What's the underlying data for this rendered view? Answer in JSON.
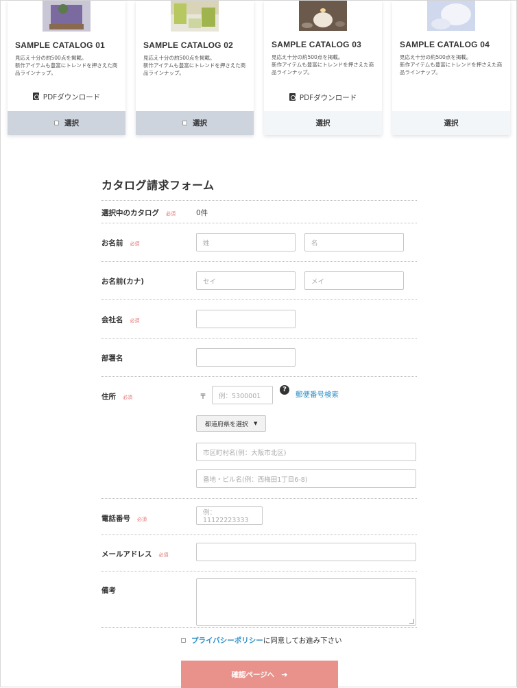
{
  "catalogs": [
    {
      "title": "SAMPLE CATALOG 01",
      "desc_line1": "見応え十分の約500点を掲載。",
      "desc_line2": "新作アイテムも豊富にトレンドを押さえた商品ラインナップ。",
      "pdf_label": "PDFダウンロード",
      "select_label": "選択",
      "has_pdf": true,
      "state": "checkbox"
    },
    {
      "title": "SAMPLE CATALOG 02",
      "desc_line1": "見応え十分の約500点を掲載。",
      "desc_line2": "新作アイテムも豊富にトレンドを押さえた商品ラインナップ。",
      "pdf_label": "",
      "select_label": "選択",
      "has_pdf": false,
      "state": "checkbox"
    },
    {
      "title": "SAMPLE CATALOG 03",
      "desc_line1": "見応え十分の約500点を掲載。",
      "desc_line2": "新作アイテムも豊富にトレンドを押さえた商品ラインナップ。",
      "pdf_label": "PDFダウンロード",
      "select_label": "選択",
      "has_pdf": true,
      "state": "plain"
    },
    {
      "title": "SAMPLE CATALOG 04",
      "desc_line1": "見応え十分の約500点を掲載。",
      "desc_line2": "新作アイテムも豊富にトレンドを押さえた商品ラインナップ。",
      "pdf_label": "",
      "select_label": "選択",
      "has_pdf": false,
      "state": "plain"
    }
  ],
  "form": {
    "title": "カタログ請求フォーム",
    "required_mark": "必須",
    "selected_catalog": {
      "label": "選択中のカタログ",
      "value": "0件"
    },
    "name": {
      "label": "お名前",
      "last_placeholder": "姓",
      "first_placeholder": "名"
    },
    "name_kana": {
      "label": "お名前(カナ)",
      "last_placeholder": "セイ",
      "first_placeholder": "メイ"
    },
    "company": {
      "label": "会社名"
    },
    "department": {
      "label": "部署名"
    },
    "address": {
      "label": "住所",
      "zip_mark": "〒",
      "zip_placeholder": "例：5300001",
      "zip_help": "?",
      "zip_search_link": "郵便番号検索",
      "prefecture_select": "都道府県を選択",
      "city_placeholder": "市区町村名(例：大阪市北区)",
      "street_placeholder": "番地・ビル名(例：西梅田1丁目6-8)"
    },
    "phone": {
      "label": "電話番号",
      "placeholder": "例：11122223333"
    },
    "email": {
      "label": "メールアドレス"
    },
    "notes": {
      "label": "備考"
    },
    "consent": {
      "privacy_link": "プライバシーポリシー",
      "text_rest": "に同意してお進み下さい"
    },
    "submit": {
      "label": "確認ページへ",
      "arrow": "➔"
    }
  },
  "colors": {
    "accent": "#e9928c",
    "link": "#2a8ec7",
    "required": "#e07070",
    "selected_bg": "#cdd4de"
  }
}
